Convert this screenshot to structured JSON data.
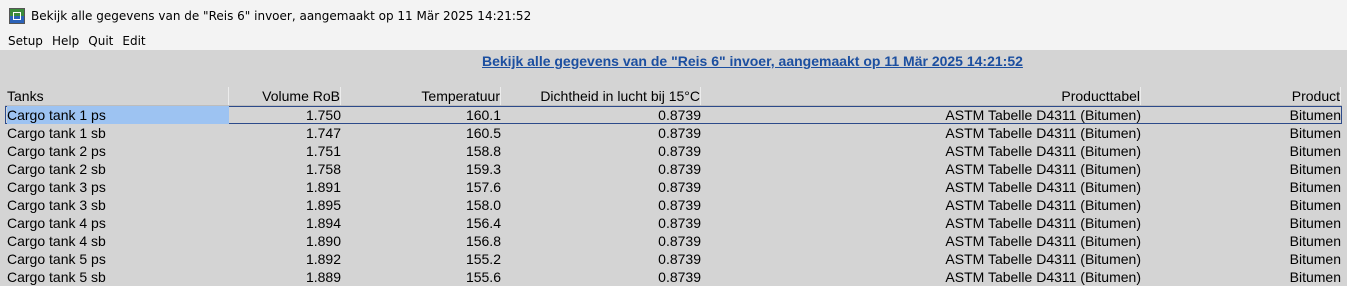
{
  "window": {
    "title": "Bekijk alle gegevens van de \"Reis 6\" invoer, aangemaakt op 11 Mär 2025  14:21:52"
  },
  "menu": [
    "Setup",
    "Help",
    "Quit",
    "Edit"
  ],
  "page": {
    "heading": "Bekijk alle gegevens van de \"Reis 6\" invoer, aangemaakt op 11 Mär 2025  14:21:52 "
  },
  "table": {
    "columns": [
      "Tanks",
      "Volume RoB",
      "Temperatuur",
      "Dichtheid in lucht bij 15°C",
      "Producttabel",
      "Product"
    ],
    "rows": [
      [
        "Cargo tank 1 ps",
        "1.750",
        "160.1",
        "0.8739",
        "ASTM Tabelle D4311 (Bitumen)",
        "Bitumen"
      ],
      [
        "Cargo tank 1 sb",
        "1.747",
        "160.5",
        "0.8739",
        "ASTM Tabelle D4311 (Bitumen)",
        "Bitumen"
      ],
      [
        "Cargo tank 2 ps",
        "1.751",
        "158.8",
        "0.8739",
        "ASTM Tabelle D4311 (Bitumen)",
        "Bitumen"
      ],
      [
        "Cargo tank 2 sb",
        "1.758",
        "159.3",
        "0.8739",
        "ASTM Tabelle D4311 (Bitumen)",
        "Bitumen"
      ],
      [
        "Cargo tank 3 ps",
        "1.891",
        "157.6",
        "0.8739",
        "ASTM Tabelle D4311 (Bitumen)",
        "Bitumen"
      ],
      [
        "Cargo tank 3 sb",
        "1.895",
        "158.0",
        "0.8739",
        "ASTM Tabelle D4311 (Bitumen)",
        "Bitumen"
      ],
      [
        "Cargo tank 4 ps",
        "1.894",
        "156.4",
        "0.8739",
        "ASTM Tabelle D4311 (Bitumen)",
        "Bitumen"
      ],
      [
        "Cargo tank 4 sb",
        "1.890",
        "156.8",
        "0.8739",
        "ASTM Tabelle D4311 (Bitumen)",
        "Bitumen"
      ],
      [
        "Cargo tank 5 ps",
        "1.892",
        "155.2",
        "0.8739",
        "ASTM Tabelle D4311 (Bitumen)",
        "Bitumen"
      ],
      [
        "Cargo tank 5 sb",
        "1.889",
        "155.6",
        "0.8739",
        "ASTM Tabelle D4311 (Bitumen)",
        "Bitumen"
      ]
    ],
    "selected_row": 0
  },
  "colors": {
    "heading": "#1c4fa0",
    "selection": "#9dc3f2",
    "background": "#d4d4d4"
  }
}
